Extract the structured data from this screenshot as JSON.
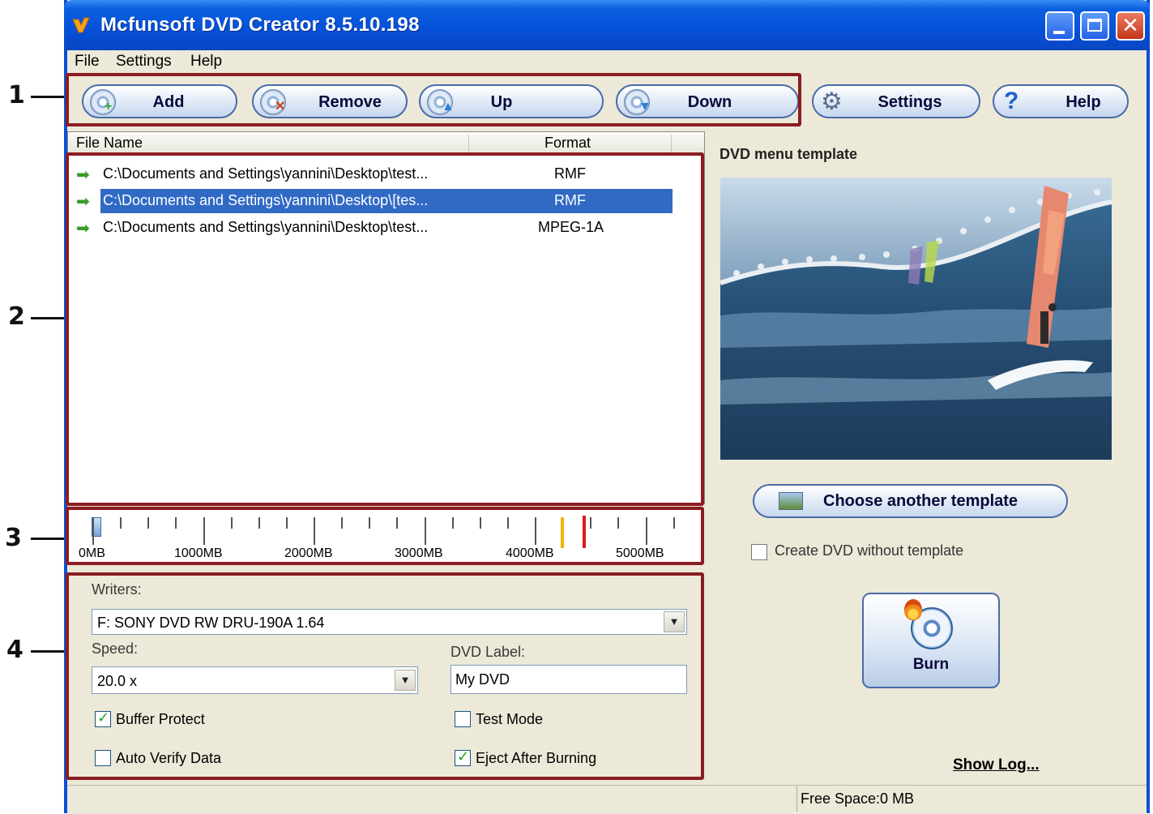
{
  "window": {
    "title": "Mcfunsoft DVD Creator 8.5.10.198"
  },
  "menu": [
    "File",
    "Settings",
    "Help"
  ],
  "toolbar": {
    "add": "Add",
    "remove": "Remove",
    "up": "Up",
    "down": "Down",
    "settings": "Settings",
    "help": "Help"
  },
  "callouts": [
    "1",
    "2",
    "3",
    "4"
  ],
  "file_list": {
    "columns": {
      "name": "File Name",
      "format": "Format"
    },
    "rows": [
      {
        "name": "C:\\Documents and Settings\\yannini\\Desktop\\test...",
        "format": "RMF",
        "selected": false
      },
      {
        "name": "C:\\Documents and Settings\\yannini\\Desktop\\[tes...",
        "format": "RMF",
        "selected": true
      },
      {
        "name": "C:\\Documents and Settings\\yannini\\Desktop\\test...",
        "format": "MPEG-1A",
        "selected": false
      }
    ]
  },
  "capacity_ruler": {
    "labels": [
      "0MB",
      "1000MB",
      "2000MB",
      "3000MB",
      "4000MB",
      "5000MB"
    ],
    "used_mb": 0,
    "markers": [
      {
        "name": "dvd5-limit",
        "color": "#f0b400"
      },
      {
        "name": "dvd-max",
        "color": "#e01b1b"
      }
    ]
  },
  "writer": {
    "writers_label": "Writers:",
    "writer_value": "F: SONY DVD RW DRU-190A 1.64",
    "speed_label": "Speed:",
    "speed_value": "20.0 x",
    "dvd_label_label": "DVD Label:",
    "dvd_label_value": "My DVD",
    "buffer_protect": {
      "label": "Buffer Protect",
      "checked": true
    },
    "auto_verify": {
      "label": "Auto Verify Data",
      "checked": false
    },
    "test_mode": {
      "label": "Test Mode",
      "checked": false
    },
    "eject_after": {
      "label": "Eject After Burning",
      "checked": true
    }
  },
  "template": {
    "title": "DVD menu template",
    "choose_button": "Choose another template",
    "without_template": {
      "label": "Create DVD without template",
      "checked": false
    }
  },
  "burn_button": "Burn",
  "show_log": "Show Log...",
  "status": {
    "free_space": "Free Space:0 MB"
  },
  "colors": {
    "titlebar": "#0550d8",
    "highlight_border": "#8b1c22",
    "selection": "#316ac5"
  }
}
